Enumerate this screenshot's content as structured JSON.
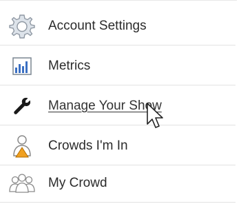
{
  "menu": {
    "items": [
      {
        "label": "Account Settings",
        "icon": "gear-icon"
      },
      {
        "label": "Metrics",
        "icon": "bar-chart-icon"
      },
      {
        "label": "Manage Your Show",
        "icon": "wrench-icon",
        "hovered": true
      },
      {
        "label": "Crowds I'm In",
        "icon": "user-warning-icon"
      },
      {
        "label": "My Crowd",
        "icon": "group-icon"
      }
    ]
  },
  "colors": {
    "text": "#2b2b2b",
    "divider": "#e2e2e2",
    "icon_gray": "#9aa3ad",
    "chart_blue": "#3b6fc2",
    "warning_orange": "#f0a020"
  }
}
